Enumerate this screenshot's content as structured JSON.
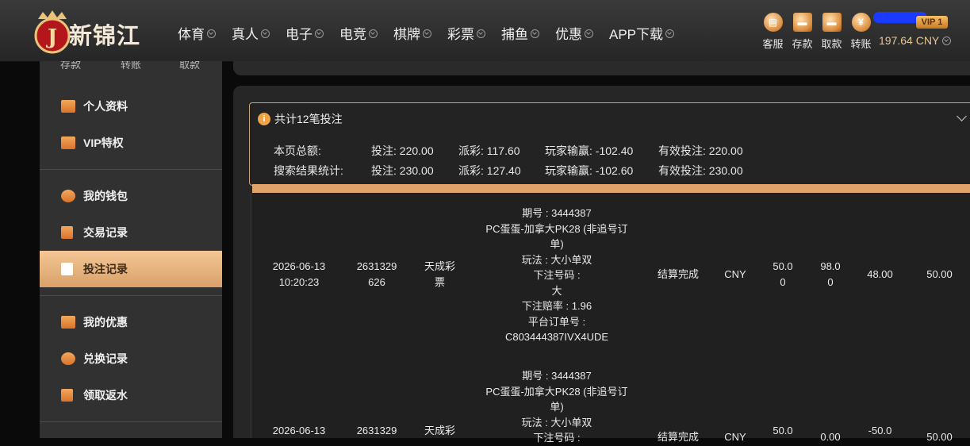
{
  "brand": {
    "name": "新锦江",
    "logo_letter": "J"
  },
  "nav": [
    {
      "label": "体育"
    },
    {
      "label": "真人"
    },
    {
      "label": "电子"
    },
    {
      "label": "电竞"
    },
    {
      "label": "棋牌"
    },
    {
      "label": "彩票"
    },
    {
      "label": "捕鱼"
    },
    {
      "label": "优惠"
    },
    {
      "label": "APP下载"
    }
  ],
  "quick": [
    {
      "label": "客服",
      "icon": "chat-icon"
    },
    {
      "label": "存款",
      "icon": "wallet-icon"
    },
    {
      "label": "取款",
      "icon": "atm-icon"
    },
    {
      "label": "转账",
      "icon": "yuan-icon"
    }
  ],
  "user": {
    "vip": "VIP 1",
    "balance": "197.64 CNY"
  },
  "sidebar": {
    "cut_labels": [
      "存款",
      "转账",
      "取款"
    ],
    "items": [
      {
        "label": "个人资料",
        "icon": "id-card-icon"
      },
      {
        "label": "VIP特权",
        "icon": "vip-card-icon"
      },
      {
        "label": "我的钱包",
        "icon": "piggy-bank-icon"
      },
      {
        "label": "交易记录",
        "icon": "ledger-icon"
      },
      {
        "label": "投注记录",
        "icon": "bet-record-icon"
      },
      {
        "label": "我的优惠",
        "icon": "gift-icon"
      },
      {
        "label": "兑换记录",
        "icon": "money-bag-icon"
      },
      {
        "label": "领取返水",
        "icon": "rebate-icon"
      }
    ]
  },
  "summary": {
    "title": "共计12笔投注",
    "page_label": "本页总额:",
    "search_label": "搜索结果统计:",
    "page": {
      "bet": "投注: 220.00",
      "payout": "派彩: 117.60",
      "winloss": "玩家输赢: -102.40",
      "valid": "有效投注: 220.00"
    },
    "search": {
      "bet": "投注: 230.00",
      "payout": "派彩: 127.40",
      "winloss": "玩家输赢: -102.60",
      "valid": "有效投注: 230.00"
    }
  },
  "rows": [
    {
      "date": "2026-06-13",
      "time": "10:20:23",
      "id1": "2631329",
      "id2": "626",
      "platform1": "天成彩",
      "platform2": "票",
      "detail": [
        "期号 : 3444387",
        "PC蛋蛋-加拿大PK28 (非追号订",
        "单)",
        "玩法 : 大小单双",
        "下注号码 :",
        "大",
        "下注赔率 : 1.96",
        "平台订单号 :",
        "C803444387IVX4UDE"
      ],
      "status": "结算完成",
      "currency": "CNY",
      "bet1": "50.0",
      "bet2": "0",
      "payout1": "98.0",
      "payout2": "0",
      "winloss": "48.00",
      "valid": "50.00"
    },
    {
      "date": "2026-06-13",
      "time": "",
      "id1": "2631329",
      "id2": "",
      "platform1": "天成彩",
      "platform2": "",
      "detail": [
        "期号 : 3444387",
        "PC蛋蛋-加拿大PK28 (非追号订",
        "单)",
        "玩法 : 大小单双",
        "下注号码 :"
      ],
      "status": "结算完成",
      "currency": "CNY",
      "bet1": "50.0",
      "bet2": "",
      "payout1": "0.00",
      "payout2": "",
      "winloss": "-50.0",
      "valid": "50.00"
    }
  ]
}
